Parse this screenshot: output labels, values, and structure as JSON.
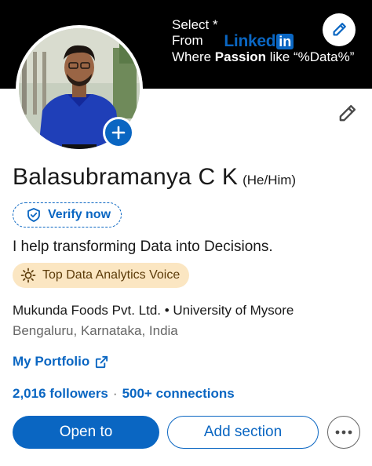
{
  "banner": {
    "line1": "Select *",
    "from_label": "From",
    "brand_text": "Linked",
    "brand_box": "in",
    "line3_prefix": "Where ",
    "line3_bold": "Passion",
    "line3_suffix": " like “%Data%”"
  },
  "profile": {
    "name": "Balasubramanya C K",
    "pronouns": "(He/Him)",
    "verify_label": "Verify now",
    "headline": "I help transforming Data into Decisions.",
    "badge": "Top Data Analytics Voice",
    "organization": "Mukunda Foods Pvt. Ltd. • University of Mysore",
    "location": "Bengaluru, Karnataka, India",
    "portfolio_label": "My Portfolio",
    "followers": "2,016 followers",
    "stats_separator": "·",
    "connections": "500+ connections"
  },
  "actions": {
    "open_to": "Open to",
    "add_section": "Add section"
  },
  "colors": {
    "accent": "#0a66c2",
    "badge_bg": "#fbe6c2",
    "badge_text": "#5c3b09"
  },
  "icons": [
    "pencil-icon",
    "plus-icon",
    "shield-check-icon",
    "sun-icon",
    "external-link-icon",
    "more-dots-icon"
  ]
}
